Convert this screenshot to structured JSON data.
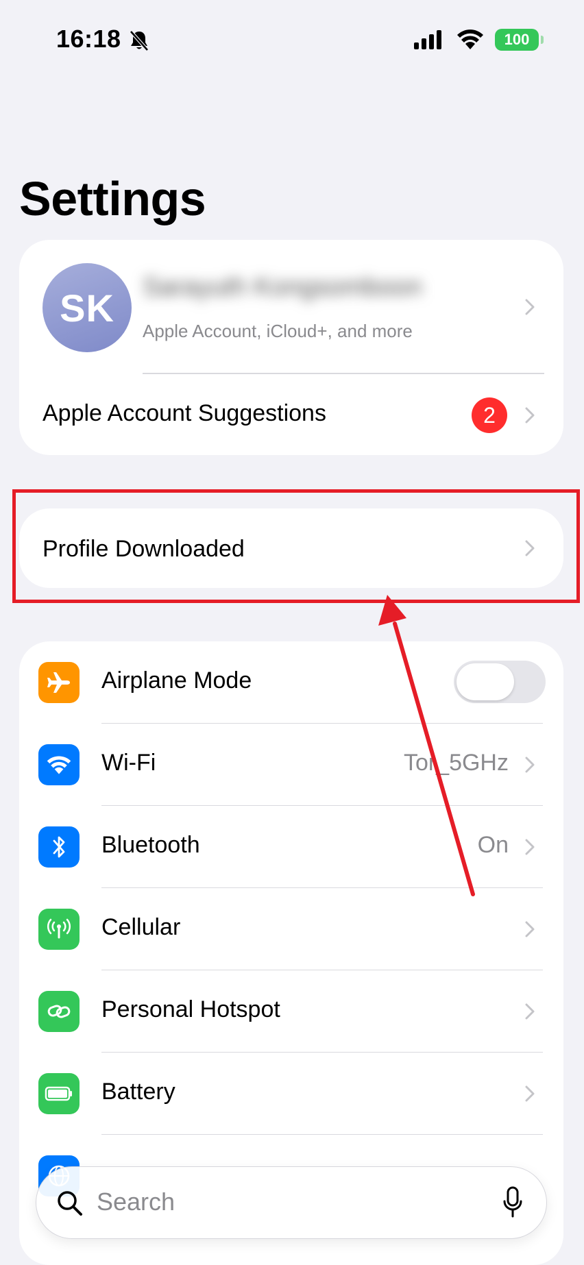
{
  "status_bar": {
    "time": "16:18",
    "battery": "100",
    "icons": [
      "bell-slash-icon",
      "cellular-signal-icon",
      "wifi-icon",
      "battery-icon"
    ]
  },
  "page": {
    "title": "Settings"
  },
  "account": {
    "initials": "SK",
    "name": "Sarayuth Kongsomboon",
    "subtitle": "Apple Account, iCloud+, and more",
    "suggestions_label": "Apple Account Suggestions",
    "suggestions_count": "2"
  },
  "profile": {
    "label": "Profile Downloaded"
  },
  "settings": {
    "items": [
      {
        "label": "Airplane Mode",
        "icon": "airplane-icon",
        "color": "#ff9500",
        "toggle_on": false
      },
      {
        "label": "Wi-Fi",
        "icon": "wifi-icon",
        "color": "#007aff",
        "value": "Tor_5GHz"
      },
      {
        "label": "Bluetooth",
        "icon": "bluetooth-icon",
        "color": "#007aff",
        "value": "On"
      },
      {
        "label": "Cellular",
        "icon": "cellular-antenna-icon",
        "color": "#34c759"
      },
      {
        "label": "Personal Hotspot",
        "icon": "hotspot-link-icon",
        "color": "#34c759"
      },
      {
        "label": "Battery",
        "icon": "battery-icon",
        "color": "#34c759"
      }
    ]
  },
  "search": {
    "placeholder": "Search"
  },
  "annotation": {
    "highlight_color": "#e51d27"
  }
}
